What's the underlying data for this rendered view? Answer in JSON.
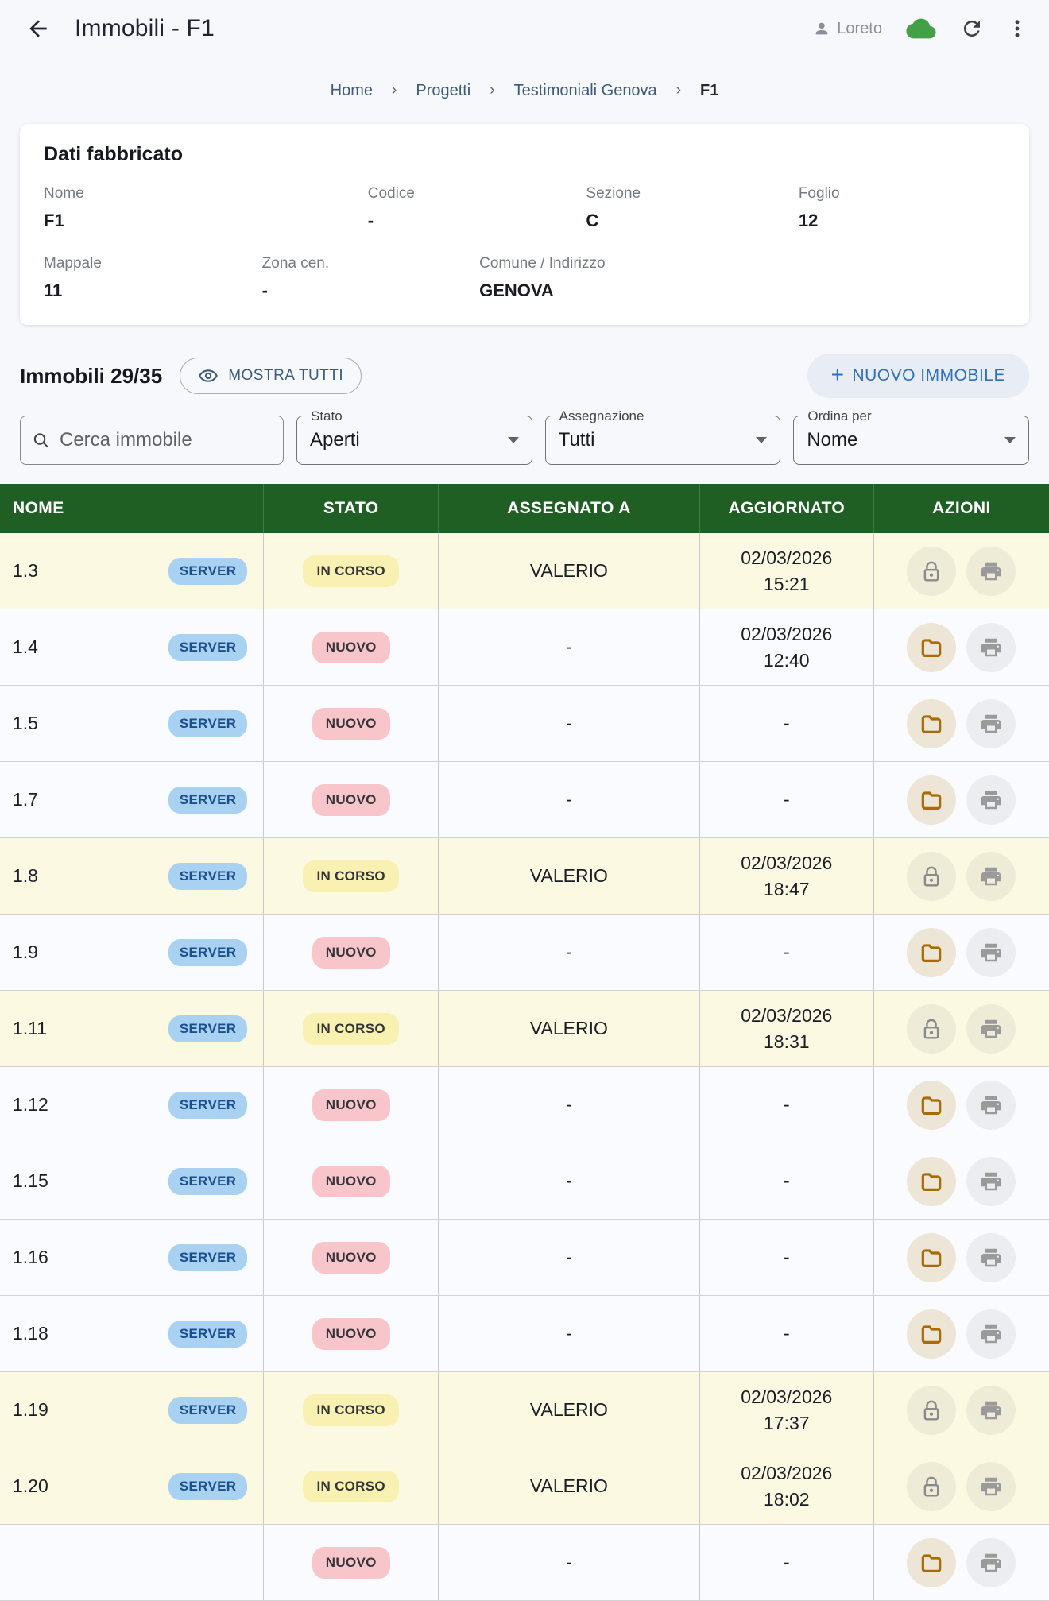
{
  "header": {
    "title": "Immobili - F1",
    "user": "Loreto"
  },
  "breadcrumb": {
    "items": [
      "Home",
      "Progetti",
      "Testimoniali Genova"
    ],
    "current": "F1",
    "separator": "›"
  },
  "building_card": {
    "title": "Dati fabbricato",
    "fields_row1": [
      {
        "label": "Nome",
        "value": "F1"
      },
      {
        "label": "Codice",
        "value": "-"
      },
      {
        "label": "Sezione",
        "value": "C"
      },
      {
        "label": "Foglio",
        "value": "12"
      }
    ],
    "fields_row2": [
      {
        "label": "Mappale",
        "value": "11"
      },
      {
        "label": "Zona cen.",
        "value": "-"
      },
      {
        "label": "Comune / Indirizzo",
        "value": "GENOVA"
      }
    ]
  },
  "toolbar": {
    "count_label": "Immobili 29/35",
    "show_all_label": "MOSTRA TUTTI",
    "plus": "+",
    "new_button_label": "NUOVO IMMOBILE"
  },
  "filters": {
    "search_placeholder": "Cerca immobile",
    "selects": [
      {
        "label": "Stato",
        "value": "Aperti"
      },
      {
        "label": "Assegnazione",
        "value": "Tutti"
      },
      {
        "label": "Ordina per",
        "value": "Nome"
      }
    ]
  },
  "table": {
    "columns": [
      "NOME",
      "STATO",
      "ASSEGNATO A",
      "AGGIORNATO",
      "AZIONI"
    ],
    "source_badge": "SERVER",
    "rows": [
      {
        "name": "1.3",
        "status": "IN CORSO",
        "status_key": "in_corso",
        "assigned": "VALERIO",
        "date": "02/03/2026",
        "time": "15:21"
      },
      {
        "name": "1.4",
        "status": "NUOVO",
        "status_key": "nuovo",
        "assigned": "-",
        "date": "02/03/2026",
        "time": "12:40"
      },
      {
        "name": "1.5",
        "status": "NUOVO",
        "status_key": "nuovo",
        "assigned": "-",
        "date": "-",
        "time": ""
      },
      {
        "name": "1.7",
        "status": "NUOVO",
        "status_key": "nuovo",
        "assigned": "-",
        "date": "-",
        "time": ""
      },
      {
        "name": "1.8",
        "status": "IN CORSO",
        "status_key": "in_corso",
        "assigned": "VALERIO",
        "date": "02/03/2026",
        "time": "18:47"
      },
      {
        "name": "1.9",
        "status": "NUOVO",
        "status_key": "nuovo",
        "assigned": "-",
        "date": "-",
        "time": ""
      },
      {
        "name": "1.11",
        "status": "IN CORSO",
        "status_key": "in_corso",
        "assigned": "VALERIO",
        "date": "02/03/2026",
        "time": "18:31"
      },
      {
        "name": "1.12",
        "status": "NUOVO",
        "status_key": "nuovo",
        "assigned": "-",
        "date": "-",
        "time": ""
      },
      {
        "name": "1.15",
        "status": "NUOVO",
        "status_key": "nuovo",
        "assigned": "-",
        "date": "-",
        "time": ""
      },
      {
        "name": "1.16",
        "status": "NUOVO",
        "status_key": "nuovo",
        "assigned": "-",
        "date": "-",
        "time": ""
      },
      {
        "name": "1.18",
        "status": "NUOVO",
        "status_key": "nuovo",
        "assigned": "-",
        "date": "-",
        "time": ""
      },
      {
        "name": "1.19",
        "status": "IN CORSO",
        "status_key": "in_corso",
        "assigned": "VALERIO",
        "date": "02/03/2026",
        "time": "17:37"
      },
      {
        "name": "1.20",
        "status": "IN CORSO",
        "status_key": "in_corso",
        "assigned": "VALERIO",
        "date": "02/03/2026",
        "time": "18:02"
      },
      {
        "name": "",
        "status": "NUOVO",
        "status_key": "nuovo",
        "assigned": "-",
        "date": "-",
        "time": ""
      }
    ]
  },
  "icons": {
    "back": "arrow-left",
    "user": "person",
    "sync": "cloud",
    "refresh": "refresh",
    "menu": "kebab-vertical",
    "show_all": "eye",
    "new": "plus",
    "search": "magnifier",
    "select_caret": "triangle-down",
    "locked_action": "lock",
    "open_action": "folder",
    "print_action": "printer"
  },
  "colors": {
    "header_green": "#1f5f24",
    "page_bg": "#f7f8fb",
    "row_in_corso_bg": "#fcf9e3",
    "row_nuovo_bg": "#fafbfe",
    "badge_server_bg": "#a9d1f2",
    "badge_server_text": "#1c4f8f",
    "pill_in_corso_bg": "#f8f1b2",
    "pill_nuovo_bg": "#f8c6ca",
    "link_blue": "#3c5a7a",
    "action_blue": "#2e6fc2",
    "cloud_green": "#43a047",
    "folder_icon": "#a86b07"
  }
}
